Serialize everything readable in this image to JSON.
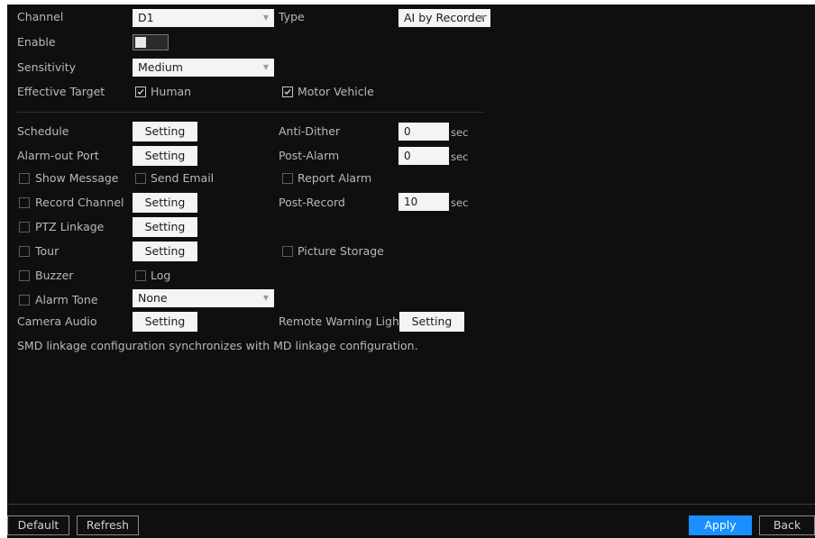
{
  "channel": {
    "label": "Channel",
    "value": "D1"
  },
  "type": {
    "label": "Type",
    "value": "AI by Recorder"
  },
  "enable": {
    "label": "Enable"
  },
  "sensitivity": {
    "label": "Sensitivity",
    "value": "Medium"
  },
  "effective_target": {
    "label": "Effective Target",
    "human": "Human",
    "motor_vehicle": "Motor Vehicle"
  },
  "schedule": {
    "label": "Schedule",
    "button": "Setting"
  },
  "anti_dither": {
    "label": "Anti-Dither",
    "value": "0",
    "unit": "sec"
  },
  "alarm_out_port": {
    "label": "Alarm-out Port",
    "button": "Setting"
  },
  "post_alarm": {
    "label": "Post-Alarm",
    "value": "0",
    "unit": "sec"
  },
  "show_message": {
    "label": "Show Message"
  },
  "send_email": {
    "label": "Send Email"
  },
  "report_alarm": {
    "label": "Report Alarm"
  },
  "record_channel": {
    "label": "Record Channel",
    "button": "Setting"
  },
  "post_record": {
    "label": "Post-Record",
    "value": "10",
    "unit": "sec"
  },
  "ptz_linkage": {
    "label": "PTZ Linkage",
    "button": "Setting"
  },
  "tour": {
    "label": "Tour",
    "button": "Setting"
  },
  "picture_storage": {
    "label": "Picture Storage"
  },
  "buzzer": {
    "label": "Buzzer"
  },
  "log": {
    "label": "Log"
  },
  "alarm_tone": {
    "label": "Alarm Tone",
    "value": "None"
  },
  "camera_audio": {
    "label": "Camera Audio",
    "button": "Setting"
  },
  "remote_warning_light": {
    "label": "Remote Warning Light",
    "button": "Setting"
  },
  "note": "SMD linkage configuration synchronizes with MD linkage configuration.",
  "footer": {
    "default": "Default",
    "refresh": "Refresh",
    "apply": "Apply",
    "back": "Back"
  },
  "colors": {
    "background": "#0f0f0f",
    "accent": "#1a8fff",
    "text": "#b9b9b9"
  }
}
